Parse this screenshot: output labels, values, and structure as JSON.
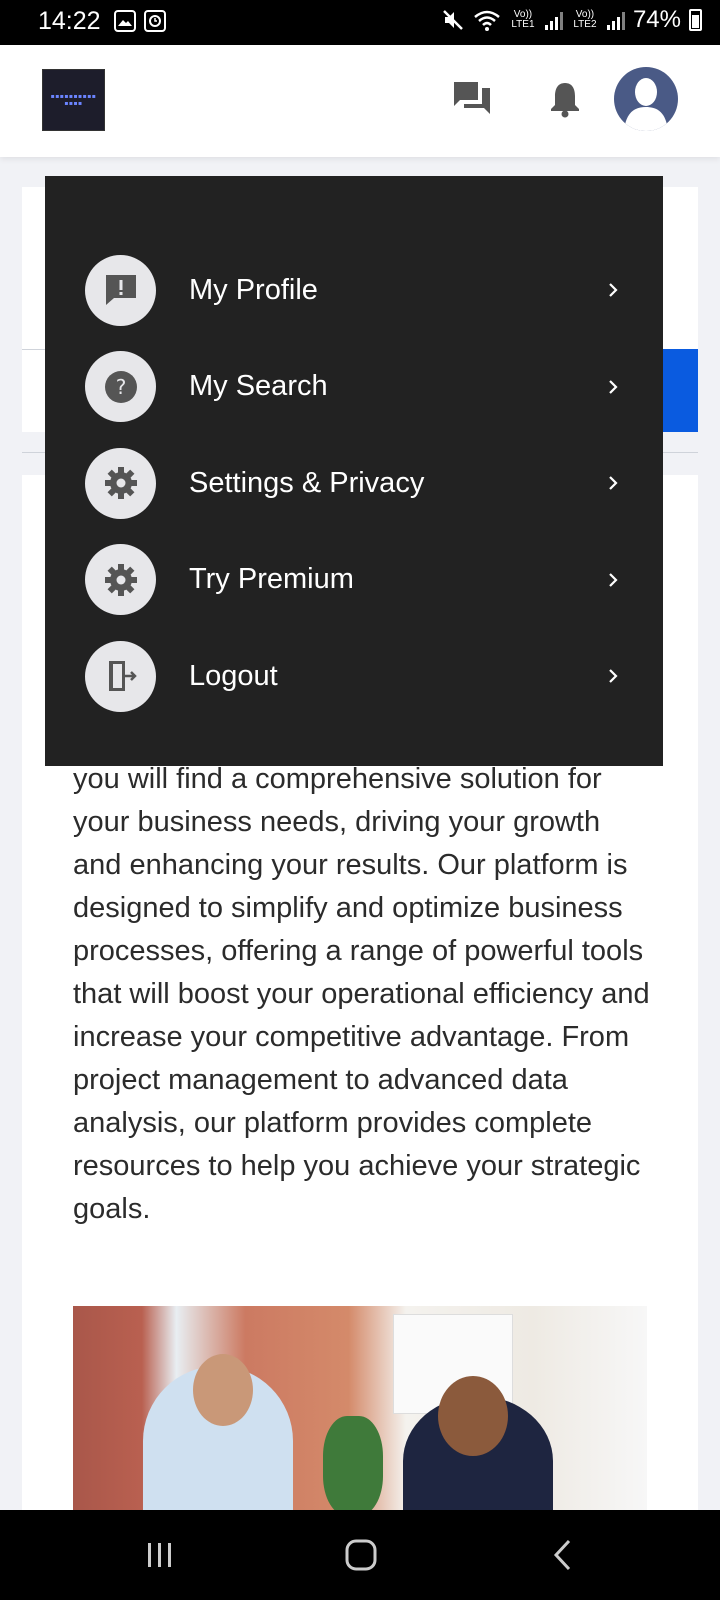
{
  "status_bar": {
    "time": "14:22",
    "battery": "74%",
    "sim1": "Vo)) LTE1",
    "sim2": "Vo)) LTE2",
    "icons": [
      "gallery-icon",
      "screen-record-icon",
      "mute-icon",
      "wifi-icon",
      "signal-icon",
      "battery-icon"
    ]
  },
  "header": {
    "icons": [
      "logo",
      "chat-icon",
      "bell-icon",
      "avatar"
    ]
  },
  "menu": {
    "items": [
      {
        "label": "My Profile",
        "icon": "alert-icon"
      },
      {
        "label": "My Search",
        "icon": "question-icon"
      },
      {
        "label": "Settings & Privacy",
        "icon": "gear-icon"
      },
      {
        "label": "Try Premium",
        "icon": "gear-icon"
      },
      {
        "label": "Logout",
        "icon": "logout-icon"
      }
    ]
  },
  "content": {
    "paragraph": "you will find a comprehensive solution for your business needs, driving your growth and enhancing your results. Our platform is designed to simplify and optimize business processes, offering a range of powerful tools that will boost your operational efficiency and increase your competitive advantage. From project management to advanced data analysis, our platform provides complete resources to help you achieve your strategic goals."
  },
  "colors": {
    "menu_bg": "#222222",
    "accent_blue": "#0a5be0",
    "icon_gray": "#555555"
  },
  "nav_bar": {
    "buttons": [
      "recents-icon",
      "home-icon",
      "back-icon"
    ]
  }
}
